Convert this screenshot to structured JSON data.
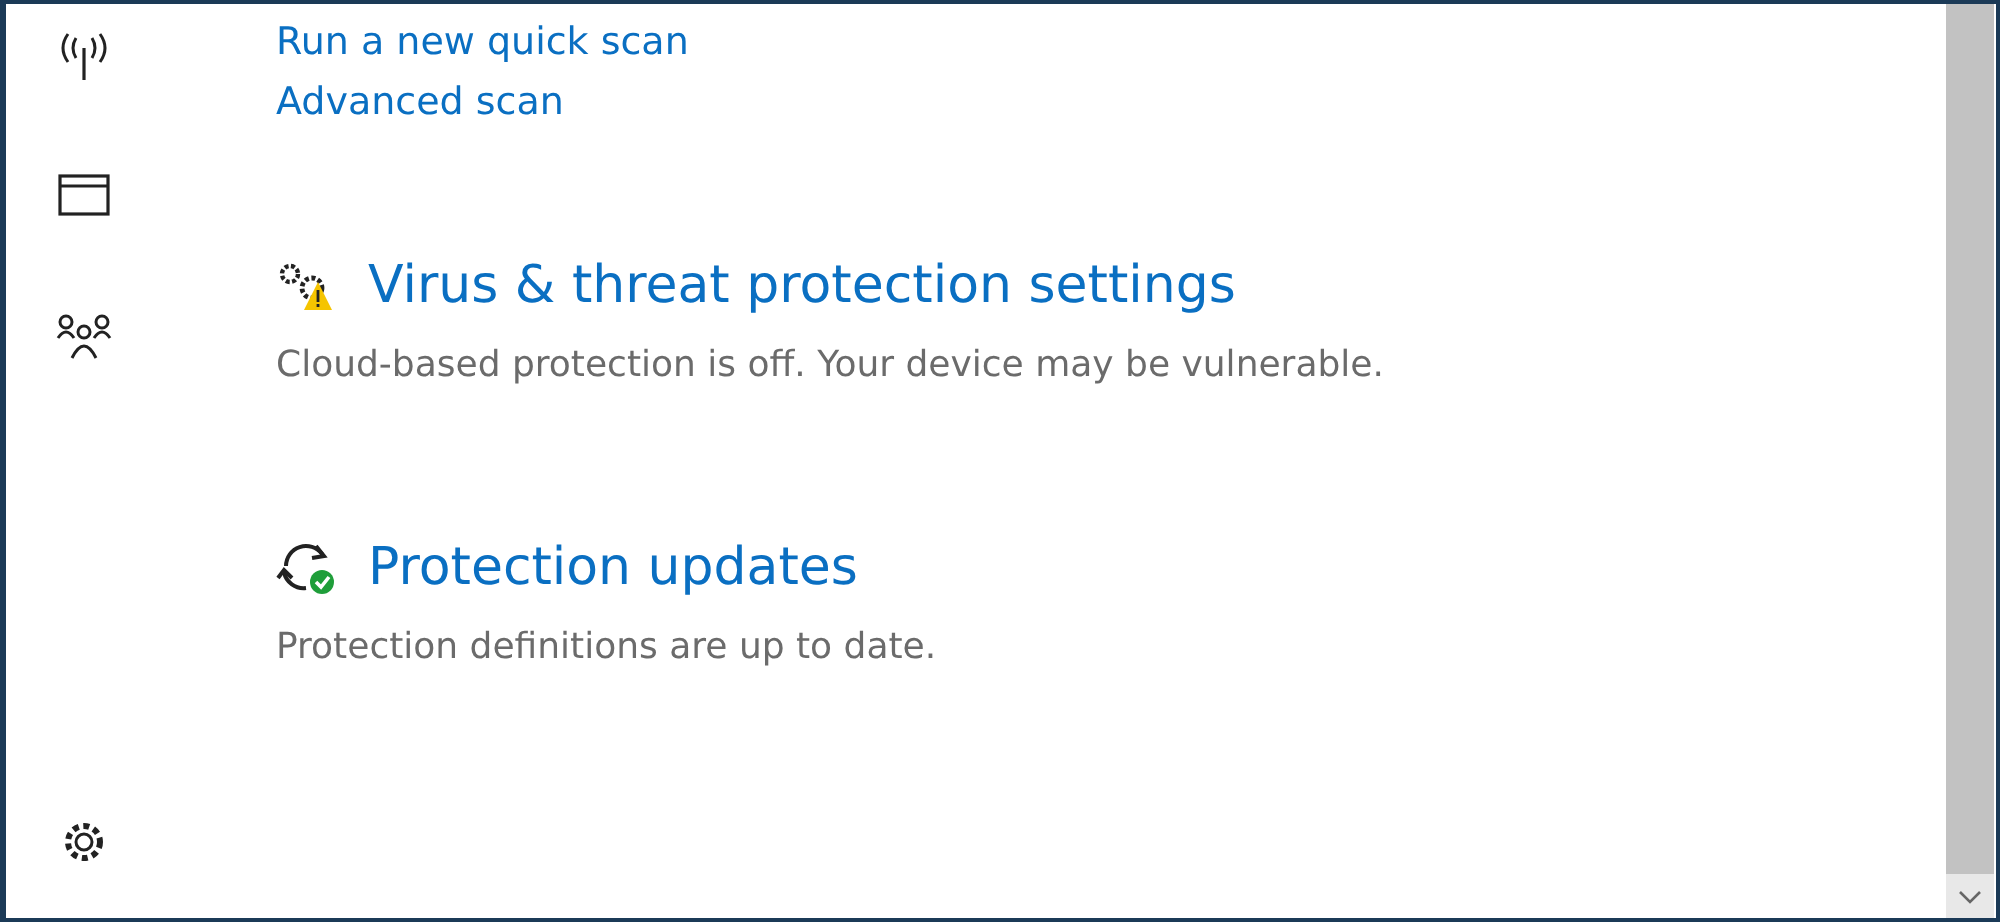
{
  "scan_links": [
    "Run a new quick scan",
    "Advanced scan"
  ],
  "sections": [
    {
      "kind": "warning-settings",
      "title": "Virus & threat protection settings",
      "description": "Cloud-based protection is off. Your device may be vulnerable."
    },
    {
      "kind": "updates-ok",
      "title": "Protection updates",
      "description": "Protection definitions are up to date."
    }
  ]
}
